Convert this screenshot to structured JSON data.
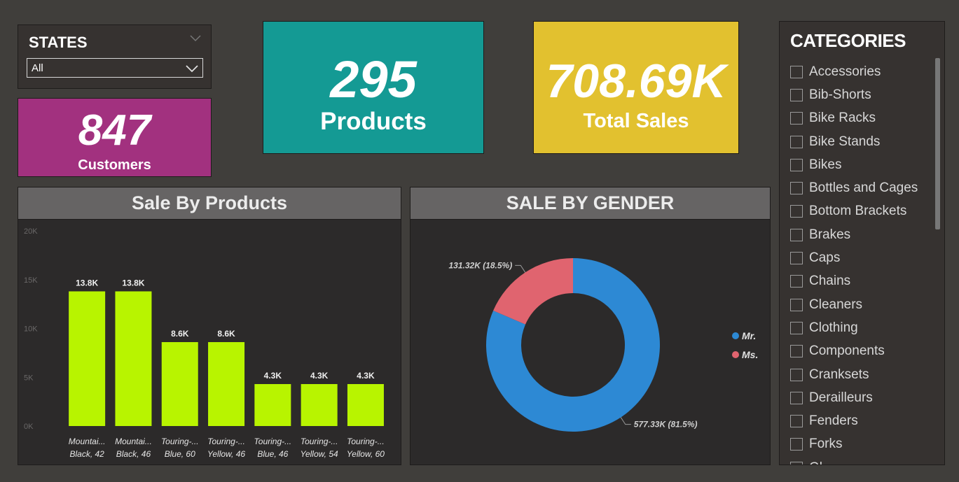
{
  "states": {
    "title": "STATES",
    "selected": "All"
  },
  "kpis": {
    "customers": {
      "value": "847",
      "label": "Customers"
    },
    "products": {
      "value": "295",
      "label": "Products"
    },
    "total_sales": {
      "value": "708.69K",
      "label": "Total Sales"
    }
  },
  "categories": {
    "title": "CATEGORIES",
    "items": [
      "Accessories",
      "Bib-Shorts",
      "Bike Racks",
      "Bike Stands",
      "Bikes",
      "Bottles and Cages",
      "Bottom Brackets",
      "Brakes",
      "Caps",
      "Chains",
      "Cleaners",
      "Clothing",
      "Components",
      "Cranksets",
      "Derailleurs",
      "Fenders",
      "Forks",
      "Gl..."
    ]
  },
  "colors": {
    "customers": "#a2317f",
    "products": "#149a94",
    "total_sales": "#e2c12f",
    "bar": "#b8f400",
    "mr": "#2d89d4",
    "ms": "#e0646f"
  },
  "chart_data": [
    {
      "type": "bar",
      "title": "Sale By Products",
      "categories": [
        [
          "Mountai...",
          "Black, 42"
        ],
        [
          "Mountai...",
          "Black, 46"
        ],
        [
          "Touring-...",
          "Blue, 60"
        ],
        [
          "Touring-...",
          "Yellow, 46"
        ],
        [
          "Touring-...",
          "Blue, 46"
        ],
        [
          "Touring-...",
          "Yellow, 54"
        ],
        [
          "Touring-...",
          "Yellow, 60"
        ]
      ],
      "values": [
        13800,
        13800,
        8600,
        8600,
        4300,
        4300,
        4300
      ],
      "data_labels": [
        "13.8K",
        "13.8K",
        "8.6K",
        "8.6K",
        "4.3K",
        "4.3K",
        "4.3K"
      ],
      "ylim": [
        0,
        20000
      ],
      "yticks": [
        0,
        5000,
        10000,
        15000,
        20000
      ],
      "ytick_labels": [
        "0K",
        "5K",
        "10K",
        "15K",
        "20K"
      ]
    },
    {
      "type": "pie",
      "title": "SALE BY GENDER",
      "labels": [
        "Mr.",
        "Ms."
      ],
      "values": [
        577.33,
        131.32
      ],
      "data_labels": [
        "577.33K (81.5%)",
        "131.32K (18.5%)"
      ],
      "legend": "right"
    }
  ]
}
